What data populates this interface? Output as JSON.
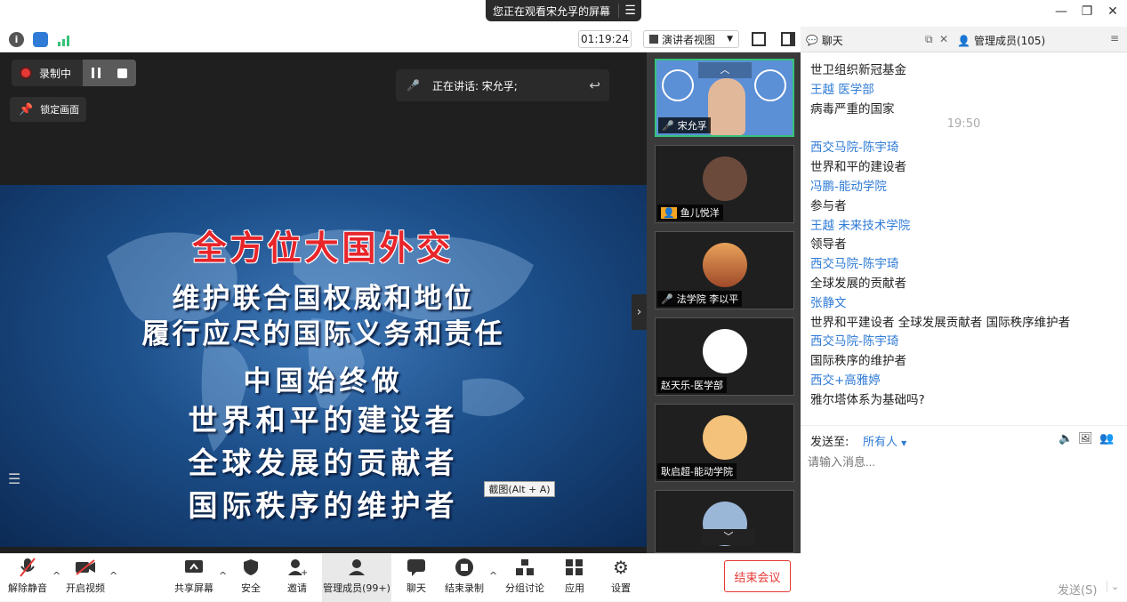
{
  "titlebar": {
    "share_banner": "您正在观看宋允孚的屏幕",
    "menu_icon": "list-icon"
  },
  "statusbar": {
    "timer": "01:19:24",
    "view_mode": "演讲者视图"
  },
  "stage": {
    "recording": "录制中",
    "lock_screen": "锁定画面",
    "speaking": "正在讲话: 宋允孚;",
    "screenshot_tip": "截图(Alt + A)",
    "slide": {
      "title": "全方位大国外交",
      "lines": [
        "维护联合国权威和地位",
        "履行应尽的国际义务和责任",
        "中国始终做",
        "世界和平的建设者",
        "全球发展的贡献者",
        "国际秩序的维护者"
      ]
    }
  },
  "participants": [
    {
      "name": "宋允孚"
    },
    {
      "name": "鱼儿悦洋"
    },
    {
      "name": "法学院 李以平"
    },
    {
      "name": "赵天乐-医学部"
    },
    {
      "name": "耿启超-能动学院"
    }
  ],
  "chat_tabs": {
    "chat": "聊天",
    "manage": "管理成员(105)"
  },
  "chat": {
    "messages": [
      {
        "type": "body",
        "text": "世卫组织新冠基金"
      },
      {
        "type": "sender",
        "text": "王越 医学部"
      },
      {
        "type": "body",
        "text": "病毒严重的国家"
      },
      {
        "type": "time",
        "text": "19:50"
      },
      {
        "type": "sender",
        "text": "西交马院-陈宇琦"
      },
      {
        "type": "body",
        "text": "世界和平的建设者"
      },
      {
        "type": "sender",
        "text": "冯鹏-能动学院"
      },
      {
        "type": "body",
        "text": "参与者"
      },
      {
        "type": "sender",
        "text": "王越 未来技术学院"
      },
      {
        "type": "body",
        "text": "领导者"
      },
      {
        "type": "sender",
        "text": "西交马院-陈宇琦"
      },
      {
        "type": "body",
        "text": "全球发展的贡献者"
      },
      {
        "type": "sender",
        "text": "张静文"
      },
      {
        "type": "body",
        "text": "世界和平建设者 全球发展贡献者 国际秩序维护者"
      },
      {
        "type": "sender",
        "text": "西交马院-陈宇琦"
      },
      {
        "type": "body",
        "text": "国际秩序的维护者"
      },
      {
        "type": "sender",
        "text": "西交+高雅婷"
      },
      {
        "type": "body",
        "text": "雅尔塔体系为基础吗?"
      }
    ],
    "send_to_label": "发送至:",
    "send_to_value": "所有人",
    "input_placeholder": "请输入消息...",
    "send_button": "发送(S)"
  },
  "toolbar": {
    "unmute": "解除静音",
    "video": "开启视频",
    "share": "共享屏幕",
    "security": "安全",
    "invite": "邀请",
    "manage": "管理成员(99+)",
    "chat": "聊天",
    "end_record": "结束录制",
    "breakout": "分组讨论",
    "apps": "应用",
    "settings": "设置",
    "end_meeting": "结束会议"
  },
  "colors": {
    "accent": "#2f7bd6",
    "danger": "#e53935",
    "active_tile": "#35c27a"
  }
}
